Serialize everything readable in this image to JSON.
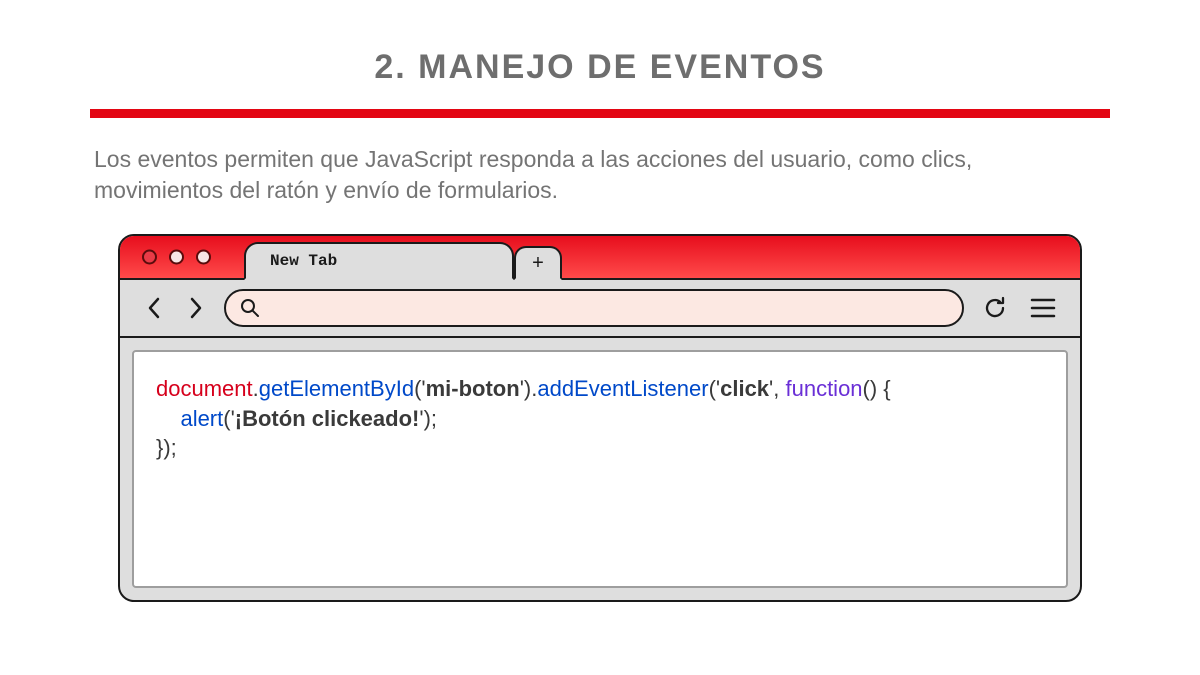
{
  "title": "2. MANEJO DE EVENTOS",
  "description": "Los eventos permiten que JavaScript responda a las acciones del usuario, como clics, movimientos del ratón y envío de formularios.",
  "browser": {
    "tab_label": "New Tab",
    "newtab_symbol": "+"
  },
  "code": {
    "tokens": [
      {
        "t": "document",
        "c": "tok-red"
      },
      {
        "t": ".",
        "c": "tok-black"
      },
      {
        "t": "getElementById",
        "c": "tok-blue"
      },
      {
        "t": "(",
        "c": "tok-black"
      },
      {
        "t": "'",
        "c": "tok-black"
      },
      {
        "t": "mi-boton",
        "c": "tok-bold"
      },
      {
        "t": "'",
        "c": "tok-black"
      },
      {
        "t": ").",
        "c": "tok-black"
      },
      {
        "t": "addEventListener",
        "c": "tok-blue"
      },
      {
        "t": "(",
        "c": "tok-black"
      },
      {
        "t": "'",
        "c": "tok-black"
      },
      {
        "t": "click",
        "c": "tok-bold"
      },
      {
        "t": "'",
        "c": "tok-black"
      },
      {
        "t": ", ",
        "c": "tok-black"
      },
      {
        "t": "function",
        "c": "tok-purple"
      },
      {
        "t": "() {",
        "c": "tok-black"
      },
      {
        "t": "\n    ",
        "c": "tok-black"
      },
      {
        "t": "alert",
        "c": "tok-blue"
      },
      {
        "t": "(",
        "c": "tok-black"
      },
      {
        "t": "'",
        "c": "tok-black"
      },
      {
        "t": "¡Botón clickeado!",
        "c": "tok-bold"
      },
      {
        "t": "'",
        "c": "tok-black"
      },
      {
        "t": ");",
        "c": "tok-black"
      },
      {
        "t": "\n});",
        "c": "tok-black"
      }
    ]
  }
}
